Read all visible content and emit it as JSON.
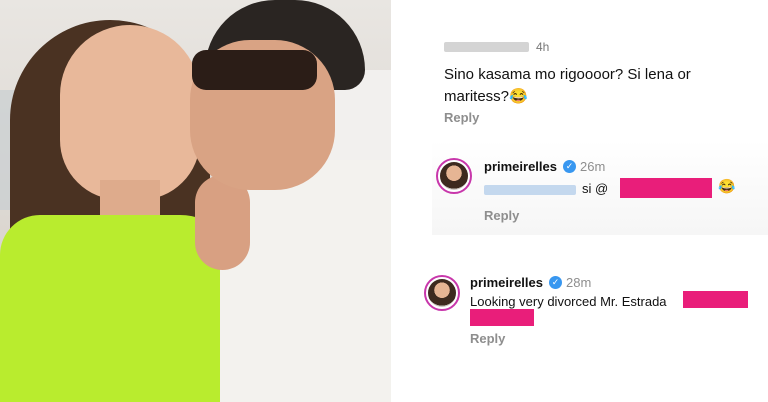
{
  "top_comment": {
    "time": "4h",
    "text": "Sino kasama mo rigoooor? Si lena or maritess?",
    "emoji": "😂",
    "reply_label": "Reply"
  },
  "reply_1": {
    "username": "primeirelles",
    "time": "26m",
    "text_prefix": "si @",
    "emoji": "😂",
    "reply_label": "Reply"
  },
  "reply_2": {
    "username": "primeirelles",
    "time": "28m",
    "text": "Looking very divorced Mr. Estrada",
    "reply_label": "Reply"
  },
  "colors": {
    "redaction": "#e91e7a",
    "verified": "#3897f0",
    "story_ring": "#c837ab",
    "dress": "#b9ec2e"
  },
  "icons": [
    "verified-badge-icon",
    "laughing-emoji-icon"
  ]
}
